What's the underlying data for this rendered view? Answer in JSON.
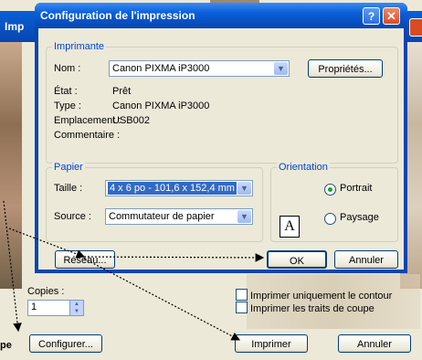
{
  "background_window": {
    "title": "Imp",
    "copies_label": "Copies :",
    "copies_value": "1",
    "options": [
      "Imprimer uniquement le contour",
      "Imprimer les traits de coupe"
    ],
    "configure_button": "Configurer...",
    "print_button": "Imprimer",
    "cancel_button": "Annuler",
    "partial_text": "pe"
  },
  "dialog": {
    "title": "Configuration de l'impression",
    "help_symbol": "?",
    "close_symbol": "✕",
    "printer_group": {
      "title": "Imprimante",
      "name_label": "Nom :",
      "name_value": "Canon PIXMA iP3000",
      "properties_button": "Propriétés...",
      "rows": [
        {
          "label": "État :",
          "value": "Prêt"
        },
        {
          "label": "Type :",
          "value": "Canon PIXMA iP3000"
        },
        {
          "label": "Emplacement :",
          "value": "USB002"
        },
        {
          "label": "Commentaire :",
          "value": ""
        }
      ]
    },
    "paper_group": {
      "title": "Papier",
      "size_label": "Taille :",
      "size_value": "4 x 6 po - 101,6 x 152,4 mm",
      "source_label": "Source :",
      "source_value": "Commutateur de papier"
    },
    "orientation_group": {
      "title": "Orientation",
      "icon_letter": "A",
      "portrait": "Portrait",
      "landscape": "Paysage",
      "selected": "Portrait"
    },
    "network_button": "Réseau...",
    "ok_button": "OK",
    "cancel_button": "Annuler"
  },
  "colors": {
    "titlebar": "#0a5fd8",
    "group_title": "#0046d5",
    "selection": "#316ac5"
  }
}
